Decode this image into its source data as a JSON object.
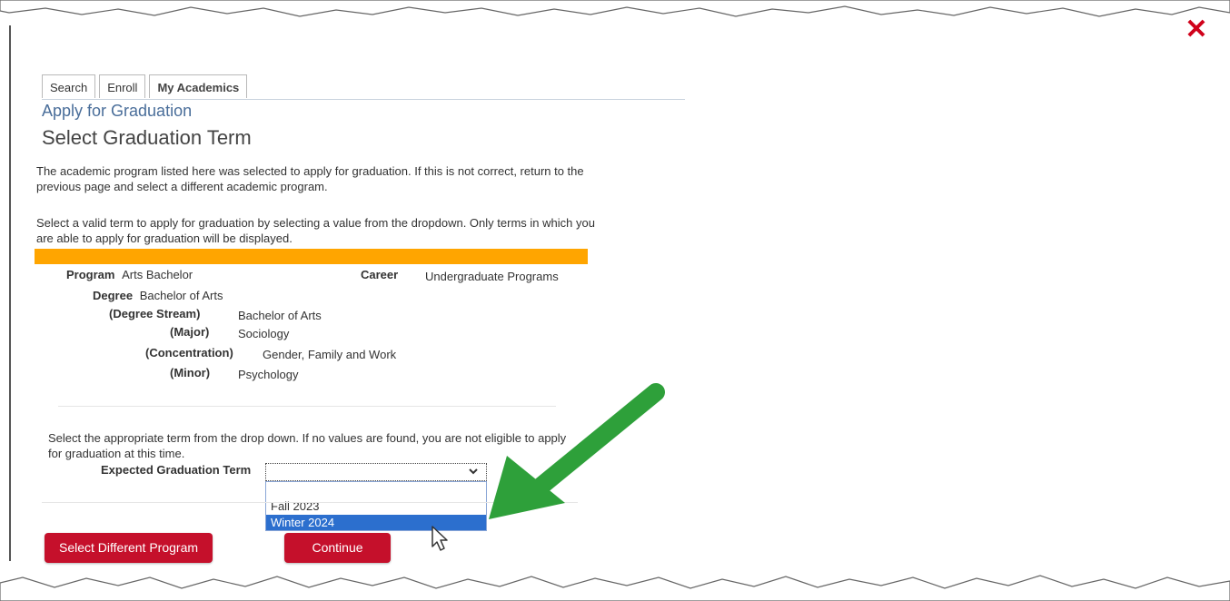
{
  "tabs": [
    "Search",
    "Enroll",
    "My Academics"
  ],
  "breadcrumb": "Apply for Graduation",
  "page_title": "Select Graduation Term",
  "intro_text_1": "The academic program listed here was selected to apply for graduation. If this is not correct, return to the previous page and select a different academic program.",
  "intro_text_2": "Select a valid term to apply for graduation by selecting a value from the dropdown. Only terms in which you are able to apply for graduation will be displayed.",
  "program": {
    "program_label": "Program",
    "program_value": "Arts Bachelor",
    "career_label": "Career",
    "career_value": "Undergraduate Programs",
    "degree_label": "Degree",
    "degree_value": "Bachelor of Arts",
    "stream_label": "(Degree Stream)",
    "stream_value": "Bachelor of Arts",
    "major_label": "(Major)",
    "major_value": "Sociology",
    "concentration_label": "(Concentration)",
    "concentration_value": "Gender, Family and Work",
    "minor_label": "(Minor)",
    "minor_value": "Psychology"
  },
  "term_instructions": "Select the appropriate term from the drop down. If no values are found, you are not eligible to apply for graduation at this time.",
  "term_select": {
    "label": "Expected Graduation Term",
    "selected_value": "",
    "options": [
      "",
      "Fall 2023",
      "Winter 2024"
    ],
    "highlighted_option": "Winter 2024"
  },
  "buttons": {
    "select_different_program": "Select Different Program",
    "continue": "Continue"
  },
  "colors": {
    "accent_red": "#c5102b",
    "orange_bar": "#ffa500",
    "link_blue": "#4a6e9a",
    "arrow_green": "#2ea03a",
    "highlight_blue": "#2c6fce"
  },
  "icons": [
    "close-icon",
    "chevron-down-icon",
    "pointer-arrow-annotation",
    "mouse-cursor-icon"
  ]
}
